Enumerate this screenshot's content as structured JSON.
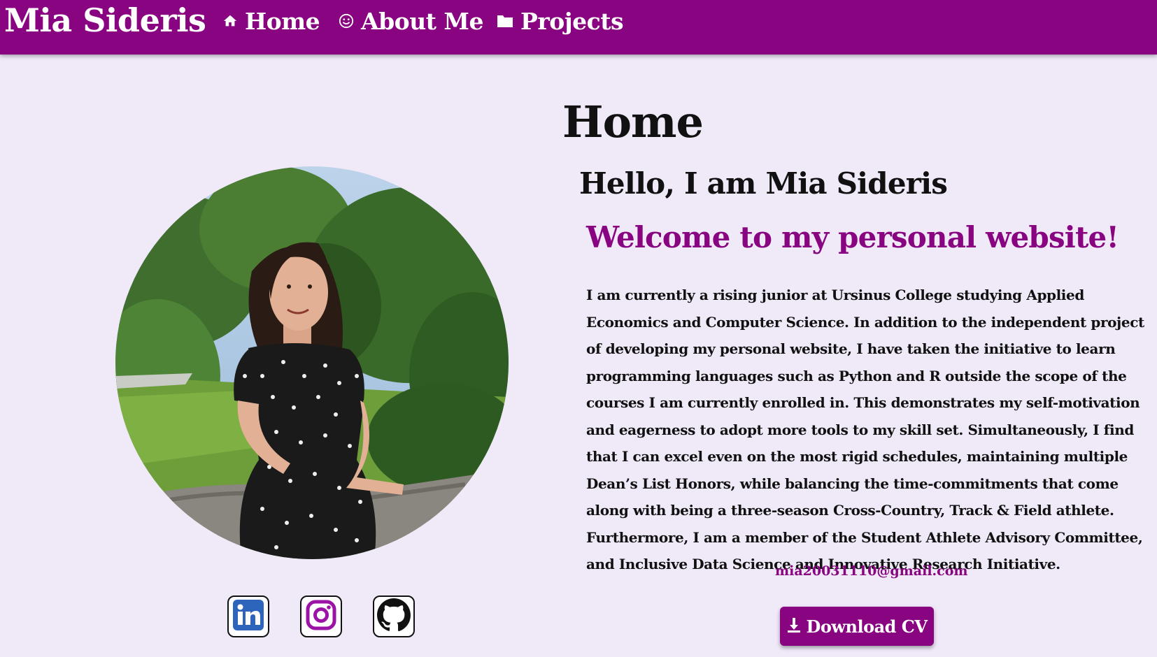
{
  "nav": {
    "brand": "Mia Sideris",
    "links": [
      {
        "label": "Home",
        "icon": "home-icon"
      },
      {
        "label": "About Me",
        "icon": "smiley-icon"
      },
      {
        "label": "Projects",
        "icon": "folder-icon"
      }
    ]
  },
  "main": {
    "page_title": "Home",
    "hello": "Hello, I am Mia Sideris",
    "welcome": "Welcome to my personal website!",
    "bio": "I am currently a rising junior at Ursinus College studying Applied Economics and Computer Science. In addition to the independent project of developing my personal website, I have taken the initiative to learn programming languages such as Python and R outside the scope of the courses I am currently enrolled in. This demonstrates my self-motivation and eagerness to adopt more tools to my skill set. Simultaneously, I find that I can excel even on the most rigid schedules, maintaining multiple Dean’s List Honors, while balancing the time-commitments that come along with being a three-season Cross-Country, Track & Field athlete. Furthermore, I am a member of the Student Athlete Advisory Committee, and Inclusive Data Science and Innovative Research Initiative.",
    "email": "mia20031110@gmail.com",
    "download_label": "Download CV"
  },
  "social": [
    "linkedin-icon",
    "instagram-icon",
    "github-icon"
  ],
  "colors": {
    "accent": "#880480",
    "background": "#efe9f8",
    "text": "#111111",
    "linkedin": "#2d64bc"
  }
}
